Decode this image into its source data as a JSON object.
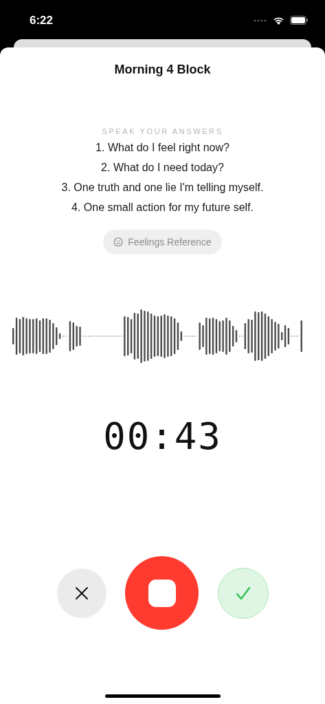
{
  "status_bar": {
    "time": "6:22"
  },
  "title": "Morning 4 Block",
  "prompt_label": "SPEAK YOUR ANSWERS",
  "questions": [
    "1. What do I feel right now?",
    "2. What do I need today?",
    "3. One truth and one lie I'm telling myself.",
    "4. One small action for my future self."
  ],
  "reference_button": {
    "label": "Feelings Reference"
  },
  "timer": "00:43"
}
